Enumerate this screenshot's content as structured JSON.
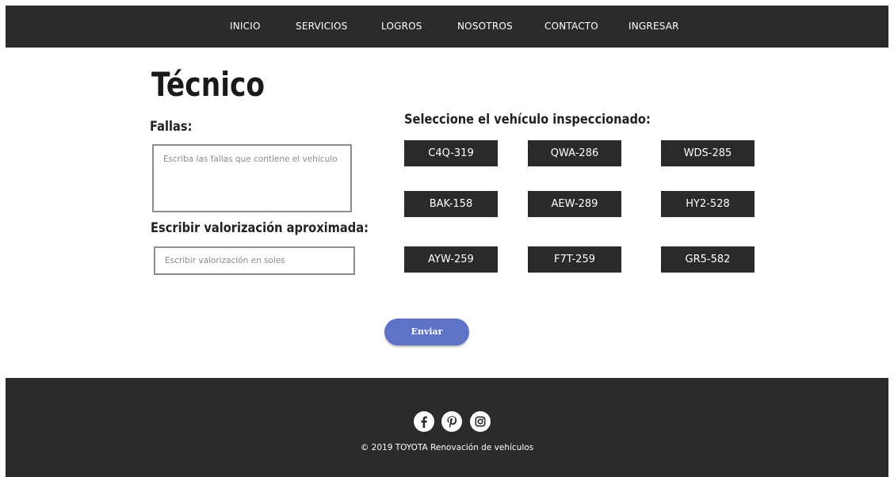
{
  "nav": {
    "items": [
      {
        "label": "INICIO"
      },
      {
        "label": "SERVICIOS"
      },
      {
        "label": "LOGROS"
      },
      {
        "label": "NOSOTROS"
      },
      {
        "label": "CONTACTO"
      },
      {
        "label": "INGRESAR"
      }
    ]
  },
  "page": {
    "title": "Técnico"
  },
  "form": {
    "faults_label": "Fallas:",
    "faults_placeholder": "Escriba las fallas que contiene el vehiculo",
    "valuation_label": "Escribir valorización aproximada:",
    "valuation_placeholder": "Escribir valorización en soles",
    "vehicle_label": "Seleccione el vehículo inspeccionado:",
    "vehicles": [
      {
        "plate": "C4Q-319"
      },
      {
        "plate": "QWA-286"
      },
      {
        "plate": "WDS-285"
      },
      {
        "plate": "BAK-158"
      },
      {
        "plate": "AEW-289"
      },
      {
        "plate": "HY2-528"
      },
      {
        "plate": "AYW-259"
      },
      {
        "plate": "F7T-259"
      },
      {
        "plate": "GR5-582"
      }
    ],
    "submit_label": "Enviar"
  },
  "footer": {
    "social": [
      {
        "icon": "facebook-icon"
      },
      {
        "icon": "pinterest-icon"
      },
      {
        "icon": "instagram-icon"
      }
    ],
    "copyright": "© 2019 TOYOTA Renovación de vehículos"
  },
  "colors": {
    "bar_bg": "#2b2b2b",
    "plate_bg": "#2a2a2a",
    "accent": "#5f73c6",
    "input_border": "#8c8c8c"
  }
}
